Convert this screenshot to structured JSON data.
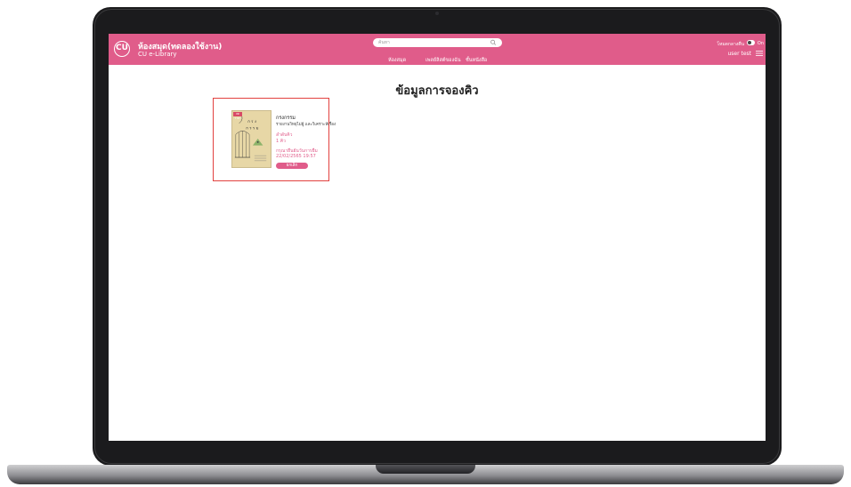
{
  "app": {
    "logo_text": "CU",
    "title": "ห้องสมุด(ทดลองใช้งาน)",
    "subtitle": "CU e-Library"
  },
  "search": {
    "placeholder": "ค้นหา"
  },
  "nav": {
    "items": [
      "ห้องสมุด",
      "เพลย์ลิสต์ของฉัน",
      "ชั้นหนังสือ"
    ]
  },
  "header_right": {
    "mode_label": "โหมดกลางคืน",
    "toggle_label": "On",
    "username": "user test"
  },
  "page": {
    "title": "ข้อมูลการจองคิว"
  },
  "reservation": {
    "book_title": "กรงกรรม",
    "author": "รายงานวิทยุไม่ผู้ และวิเคราะห์เรื่อง",
    "cover_badge": "ลดราคา",
    "queue_label": "ลำดับคิว",
    "queue_value": "1 คิว",
    "date_label": "กรุณายืนยันวันการยืม",
    "date_value": "22/02/2565 19:57",
    "cancel_label": "ยกเลิก"
  },
  "colors": {
    "brand": "#e05c8a",
    "card_border": "#e2413f"
  }
}
